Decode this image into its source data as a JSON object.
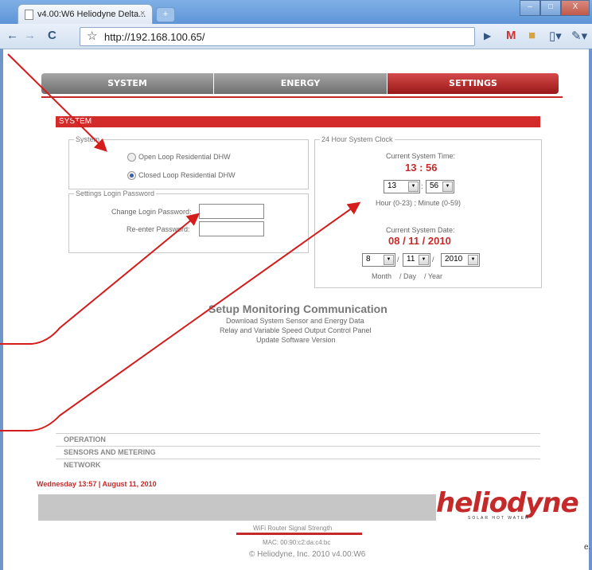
{
  "browser": {
    "tab_title": "v4.00:W6 Heliodyne Delta...",
    "tab_close": "×",
    "new_tab": "+",
    "url": "http://192.168.100.65/",
    "window_buttons": [
      "–",
      "□",
      "X"
    ]
  },
  "nav": {
    "tabs": [
      "SYSTEM",
      "ENERGY",
      "SETTINGS"
    ],
    "active": "SETTINGS"
  },
  "section_title": "SYSTEM",
  "system_box": {
    "legend": "System",
    "options": [
      "Open Loop Residential DHW",
      "Closed Loop Residential DHW"
    ],
    "selected": "Closed Loop Residential DHW"
  },
  "password_box": {
    "legend": "Settings Login Password",
    "change_label": "Change Login Password:",
    "reenter_label": "Re-enter Password:"
  },
  "clock": {
    "legend": "24 Hour System Clock",
    "time_label": "Current System Time:",
    "time_value": "13 : 56",
    "hour": "13",
    "minute": "56",
    "time_sep": ":",
    "hint": "Hour (0-23) ; Minute (0-59)",
    "date_label": "Current System Date:",
    "date_value": "08 / 11 / 2010",
    "month": "8",
    "day": "11",
    "year": "2010",
    "date_sep": "/",
    "date_hint": "Month    / Day    / Year"
  },
  "setup": {
    "title": "Setup Monitoring Communication",
    "links": [
      "Download System Sensor and Energy Data",
      "Relay and Variable Speed Output Control Panel",
      "Update Software Version"
    ]
  },
  "menu": [
    "OPERATION",
    "SENSORS AND METERING",
    "NETWORK"
  ],
  "status_datetime": "Wednesday  13:57  |  August 11, 2010",
  "footer": {
    "logo": "heliodyne",
    "logo_tagline": "SOLAR HOT WATER",
    "wifi_label": "WiFi Router Signal Strength",
    "wifi_level": 1.0,
    "mac": "MAC: 00:90:c2:da:c4:bc",
    "copyright": "© Heliodyne, Inc. 2010 v4.00:W6",
    "edge_fragment": "e."
  },
  "colors": {
    "accent_red": "#c42a2a",
    "nav_gray": "#8a8a8a",
    "chrome_blue": "#6f96c9"
  }
}
